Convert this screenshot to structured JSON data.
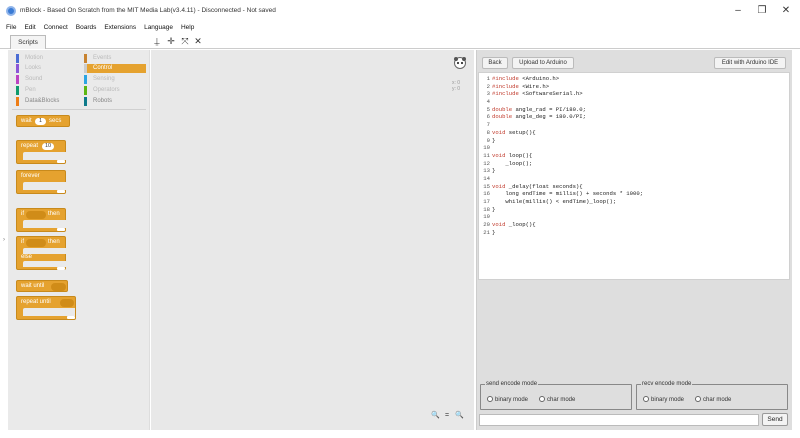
{
  "window": {
    "title": "mBlock - Based On Scratch from the MIT Media Lab(v3.4.11) - Disconnected - Not saved",
    "minimize_glyph": "–",
    "restore_glyph": "❐",
    "close_glyph": "✕"
  },
  "menu": [
    "File",
    "Edit",
    "Connect",
    "Boards",
    "Extensions",
    "Language",
    "Help"
  ],
  "tabs": {
    "scripts": "Scripts"
  },
  "toolbar": {
    "stamp": "⍊",
    "grow": "✛",
    "expand": "⤧",
    "shrink": "✕"
  },
  "categories": [
    {
      "label": "Motion",
      "color": "#4a6cd4"
    },
    {
      "label": "Events",
      "color": "#c88330"
    },
    {
      "label": "Looks",
      "color": "#8a55d7"
    },
    {
      "label": "Control",
      "color": "#e1a91a"
    },
    {
      "label": "Sound",
      "color": "#bb42c3"
    },
    {
      "label": "Sensing",
      "color": "#2ca5e2"
    },
    {
      "label": "Pen",
      "color": "#0e9a6c"
    },
    {
      "label": "Operators",
      "color": "#5cb712"
    },
    {
      "label": "Data&Blocks",
      "color": "#ee7d16"
    },
    {
      "label": "Robots",
      "color": "#0e7a8a"
    }
  ],
  "blocks": {
    "wait": "wait",
    "wait_value": "1",
    "wait_unit": "secs",
    "repeat": "repeat",
    "repeat_value": "10",
    "forever": "forever",
    "if": "if",
    "then": "then",
    "if2": "if",
    "then2": "then",
    "else": "else",
    "wait_until": "wait until",
    "repeat_until": "repeat until"
  },
  "sprite_coords": {
    "x": "x: 0",
    "y": "y: 0"
  },
  "zoom": {
    "out": "🔍",
    "reset": "=",
    "in": "🔍"
  },
  "arduino": {
    "back": "Back",
    "upload": "Upload to Arduino",
    "edit_ide": "Edit with Arduino IDE"
  },
  "code_lines": [
    {
      "n": "1",
      "kw": "#include",
      "rest": " <Arduino.h>"
    },
    {
      "n": "2",
      "kw": "#include",
      "rest": " <Wire.h>"
    },
    {
      "n": "3",
      "kw": "#include",
      "rest": " <SoftwareSerial.h>"
    },
    {
      "n": "4",
      "kw": "",
      "rest": ""
    },
    {
      "n": "5",
      "kw": "double",
      "rest": " angle_rad = PI/180.0;"
    },
    {
      "n": "6",
      "kw": "double",
      "rest": " angle_deg = 180.0/PI;"
    },
    {
      "n": "7",
      "kw": "",
      "rest": ""
    },
    {
      "n": "8",
      "kw": "void",
      "rest": " setup(){"
    },
    {
      "n": "9",
      "kw": "",
      "rest": "}"
    },
    {
      "n": "10",
      "kw": "",
      "rest": ""
    },
    {
      "n": "11",
      "kw": "void",
      "rest": " loop(){"
    },
    {
      "n": "12",
      "kw": "",
      "rest": "    _loop();"
    },
    {
      "n": "13",
      "kw": "",
      "rest": "}"
    },
    {
      "n": "14",
      "kw": "",
      "rest": ""
    },
    {
      "n": "15",
      "kw": "void",
      "rest": " _delay(float seconds){"
    },
    {
      "n": "16",
      "kw": "",
      "rest": "    long endTime = millis() + seconds * 1000;"
    },
    {
      "n": "17",
      "kw": "",
      "rest": "    while(millis() < endTime)_loop();"
    },
    {
      "n": "18",
      "kw": "",
      "rest": "}"
    },
    {
      "n": "19",
      "kw": "",
      "rest": ""
    },
    {
      "n": "20",
      "kw": "void",
      "rest": " _loop(){"
    },
    {
      "n": "21",
      "kw": "",
      "rest": "}"
    }
  ],
  "serial": {
    "send_mode_legend": "send encode mode",
    "recv_mode_legend": "recv encode mode",
    "binary": "binary mode",
    "char": "char mode",
    "send_button": "Send",
    "send_value": ""
  }
}
